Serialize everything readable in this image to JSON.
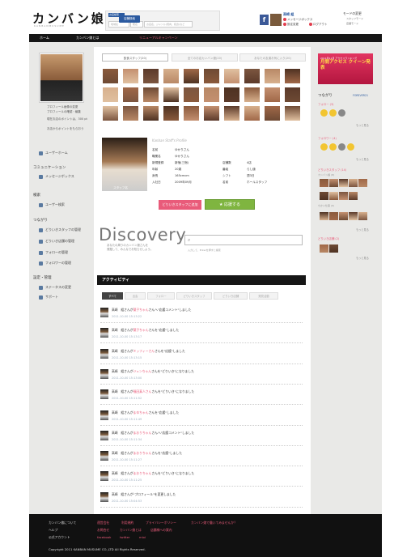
{
  "header": {
    "logo": "カンバン娘",
    "logo_sub": "KANBANMUSUME",
    "search_tag": "お店検索",
    "search_fields": [
      "地域名",
      "駅名",
      "お店名、ジャンル(焼肉、和食)など"
    ],
    "search_button": "店舗検索",
    "user_name": "高崎 組",
    "links": [
      "メッセージボックス",
      "設定変更",
      "ログアウト"
    ],
    "mode_title": "モードの変更",
    "mode_items": [
      "スタッフモード",
      "店舗モード"
    ]
  },
  "nav": [
    "ホーム",
    "カンバン娘とは",
    "リニューアルキャンペーン"
  ],
  "left": {
    "profile_lines": [
      "プロフィール画像の変更",
      "プロフィールの確認・編集",
      "現在お店のポイントは、300 pt",
      "お店からポイントをもらおう"
    ],
    "sections": [
      {
        "title": "",
        "items": [
          "ユーザーホーム"
        ]
      },
      {
        "title": "コミュニケーション",
        "items": [
          "メッセージボックス"
        ]
      },
      {
        "title": "検索",
        "items": [
          "ユーザー検索"
        ]
      },
      {
        "title": "つながり",
        "items": [
          "どりいきスタッフの管理",
          "どりいき店舗の管理",
          "フォローの管理",
          "フォロワーの管理"
        ]
      },
      {
        "title": "設定・管理",
        "items": [
          "ステータスの変更",
          "サポート"
        ]
      }
    ]
  },
  "tabs": [
    "飲食スタッフ(20)",
    "全てのお店カンバン娘(20)",
    "あなたの友達お気に入り(20)"
  ],
  "profile": {
    "title": "Kanban Staff's Profile",
    "caption": "スタッフ名",
    "rows": [
      [
        "名前",
        "ゆかりさん",
        "",
        ""
      ],
      [
        "職業名",
        "ゆかりさん",
        "",
        ""
      ],
      [
        "新規登録",
        "新宿(三宿)",
        "店舗数",
        "4店"
      ],
      [
        "年齢",
        "20歳",
        "番組",
        "らし値"
      ],
      [
        "身長",
        "165cmcm",
        "シフト",
        "週3日"
      ],
      [
        "入社日",
        "2009年09月",
        "名前",
        "ホールスタッフ"
      ]
    ]
  },
  "buttons": {
    "pink": "どりいきスタッフに追加",
    "green": "応援する"
  },
  "discovery": {
    "title": "Discovery",
    "sub1": "あなたの周りのカンバン娘さんを",
    "sub2": "発掘して、みんなでお知らせしよう。",
    "search_hint": "入力して、Enterを押すと検索"
  },
  "activity": {
    "header": "アクティビティ",
    "tabs": [
      "すべて",
      "出会",
      "フォロー",
      "どりいきスタッフ",
      "どりいき店舗",
      "発見活動"
    ],
    "items": [
      {
        "who": "高崎　組さんが",
        "name": "葉子ちゃん",
        "tail": "さんへ\"応援コメント\"しました",
        "date": "2011-10-00 15:13:22"
      },
      {
        "who": "高崎　組さんが",
        "name": "葉子ちゃん",
        "tail": "さんを\"応援\"しました",
        "date": "2011-10-00 15:13:17"
      },
      {
        "who": "高崎　組さんが",
        "name": "ミッフィーさん",
        "tail": "さんを\"応援\"しました",
        "date": "2011-10-00 15:13:15"
      },
      {
        "who": "高崎　組さんが",
        "name": "ジュンちゃん",
        "tail": "さんを\"どりいき\"になりました",
        "date": "2011-10-00 15:13:00"
      },
      {
        "who": "高崎　組さんが",
        "name": "福田真人さん",
        "tail": "さんを\"どりいき\"になりました",
        "date": "2011-10-00 15:11:52"
      },
      {
        "who": "高崎　組さんが",
        "name": "まゆちゃん",
        "tail": "さんを\"応援\"しました",
        "date": "2011-10-00 15:11:49"
      },
      {
        "who": "高崎　組さんが",
        "name": "まおりちゃん",
        "tail": "さんへ\"応援コメント\"しました",
        "date": "2011-10-00 15:11:34"
      },
      {
        "who": "高崎　組さんが",
        "name": "まおりちゃん",
        "tail": "さんを\"応援\"しました",
        "date": "2011-10-00 15:11:27"
      },
      {
        "who": "高崎　組さんが",
        "name": "まおりちゃん",
        "tail": "さんを\"どりいき\"になりました",
        "date": "2011-10-00 15:11:25"
      },
      {
        "who": "高崎　組さんが",
        "name": "",
        "tail": "\"プロフィール\"を変更しました",
        "date": "2011-10-00 15:04:53"
      }
    ]
  },
  "right": {
    "banner_top": "2011年11月\nアクセスランキング",
    "banner_main": "月間アクセス\nクイーン発表",
    "conn_title": "つながり",
    "conn_link": "FOREVER21",
    "follow": "フォロー (3)",
    "follower": "フォロワー (4)",
    "staff": "どりいきスタッフ (14)",
    "staff_sub": "カンバン娘 (8)",
    "staff_sub2": "ちかい仕事 (6)",
    "shop": "どりいき店舗 (2)",
    "more": "もっと見る"
  },
  "footer": {
    "col1": [
      "カンバン娘について",
      "ヘルプ",
      "公式アカウント"
    ],
    "row1": [
      "運営会社",
      "利用規約",
      "プライバシーポリシー",
      "カンバン娘で働いてみませんか？"
    ],
    "row2": [
      "お問合せ",
      "カンバン娘とは",
      "店舗様への案内"
    ],
    "row3": [
      "facebook",
      "twitter",
      "mixi"
    ],
    "copyright": "Copyright 2011 KANBAN MUSUME CO.,LTD All Rights Reserved."
  }
}
